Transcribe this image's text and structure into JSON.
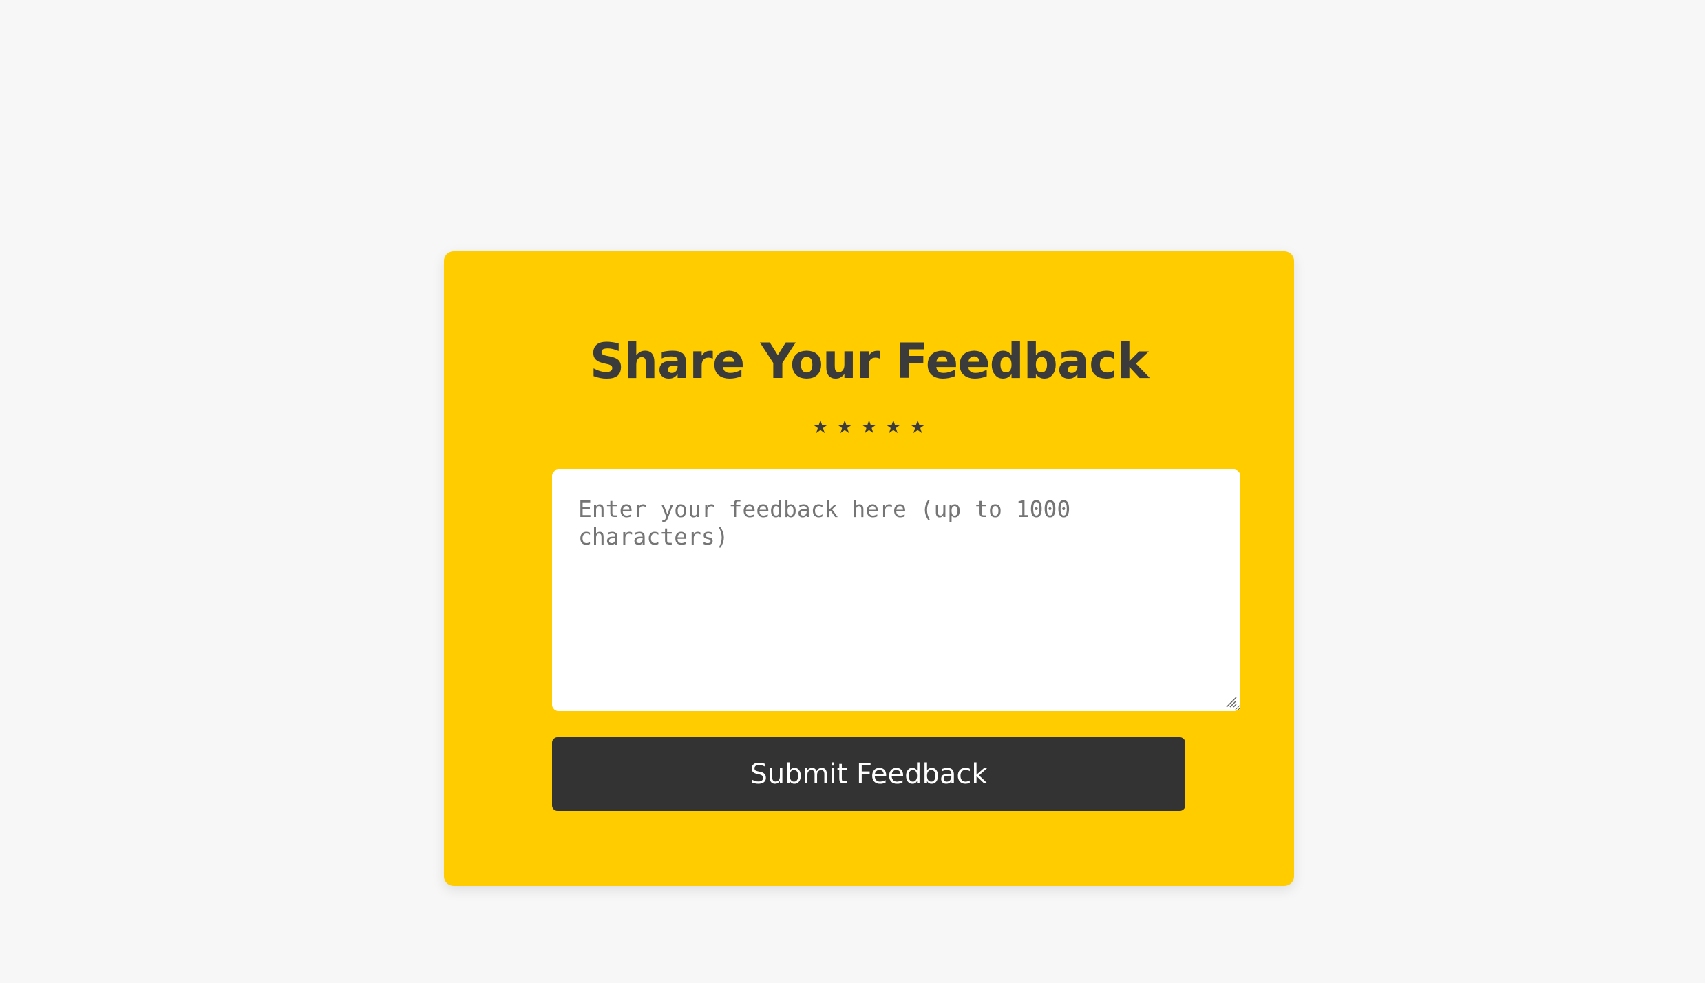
{
  "feedback": {
    "title": "Share Your Feedback",
    "rating": {
      "stars": [
        "★",
        "★",
        "★",
        "★",
        "★"
      ]
    },
    "textarea": {
      "placeholder": "Enter your feedback here (up to 1000 characters)",
      "value": ""
    },
    "submit_label": "Submit Feedback"
  },
  "colors": {
    "page_background": "#f7f7f7",
    "card_background": "#ffcc00",
    "title_color": "#3b3b3b",
    "button_background": "#333333",
    "button_text": "#ffffff"
  }
}
